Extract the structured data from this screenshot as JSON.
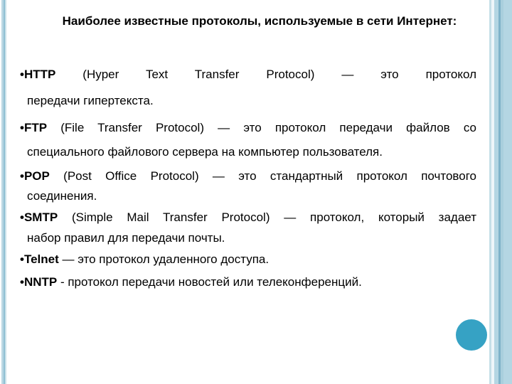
{
  "slide": {
    "title": "Наиболее известные протоколы, используемые в сети Интернет:",
    "bullet_glyph": "•",
    "items": [
      {
        "keyword": "HTTP",
        "line1": " (Hyper Text Transfer Protocol) — это протокол",
        "continuation": "передачи гипертекста."
      },
      {
        "keyword": "FTP",
        "line1": " (File Transfer Protocol) — это протокол передачи файлов со",
        "continuation": "специального файлового сервера на компьютер пользователя."
      },
      {
        "keyword": "POP",
        "line1": " (Post Office Protocol) — это стандартный протокол почтового",
        "continuation": "соединения."
      },
      {
        "keyword": "SMTP",
        "line1": " (Simple Mail Transfer Protocol) — протокол, который задает",
        "continuation": "набор правил для передачи почты."
      },
      {
        "keyword": "Telnet",
        "line1": " — это протокол удаленного доступа.",
        "continuation": ""
      },
      {
        "keyword": "NNTP",
        "line1": " - протокол передачи новостей или телеконференций.",
        "continuation": ""
      }
    ]
  },
  "theme": {
    "accent_color": "#36a2c4",
    "border_color": "#b4d6e3"
  }
}
